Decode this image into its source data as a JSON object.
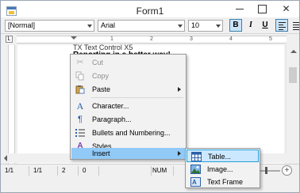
{
  "window": {
    "title": "Form1"
  },
  "toolbar": {
    "style_value": "[Normal]",
    "font_value": "Arial",
    "size_value": "10",
    "bold_label": "B",
    "italic_label": "I",
    "underline_label": "U"
  },
  "ruler": {
    "tab_selector": "L",
    "numbers": [
      "1",
      "2",
      "3",
      "4",
      "5"
    ]
  },
  "document": {
    "line1": "TX Text Control X5",
    "line2": "Reporting in a better way!"
  },
  "status_bar": {
    "page": "1/1",
    "section": "1/1",
    "line": "2",
    "column": "0",
    "num": "NUM",
    "zoom_minus": "−",
    "zoom_plus": "+"
  },
  "context_menu": {
    "items": [
      {
        "label": "Cut",
        "icon": "scissors-icon",
        "enabled": false
      },
      {
        "label": "Copy",
        "icon": "copy-icon",
        "enabled": false
      },
      {
        "label": "Paste",
        "icon": "paste-icon",
        "enabled": true,
        "submenu": true
      },
      {
        "label": "Character...",
        "icon": "character-icon",
        "enabled": true
      },
      {
        "label": "Paragraph...",
        "icon": "paragraph-icon",
        "enabled": true
      },
      {
        "label": "Bullets and Numbering...",
        "icon": "bullets-icon",
        "enabled": true
      },
      {
        "label": "Styles...",
        "icon": "styles-icon",
        "enabled": true
      },
      {
        "label": "Insert",
        "icon": "",
        "enabled": true,
        "submenu": true,
        "highlighted": true
      }
    ]
  },
  "insert_submenu": {
    "items": [
      {
        "label": "Table...",
        "icon": "table-icon",
        "highlighted": true
      },
      {
        "label": "Image...",
        "icon": "image-icon"
      },
      {
        "label": "Text Frame",
        "icon": "text-frame-icon"
      }
    ]
  },
  "colors": {
    "menu_highlight": "#91c9f7",
    "submenu_highlight": "#cce8ff",
    "submenu_highlight_border": "#26a0da",
    "button_pressed": "#cce4f7"
  }
}
